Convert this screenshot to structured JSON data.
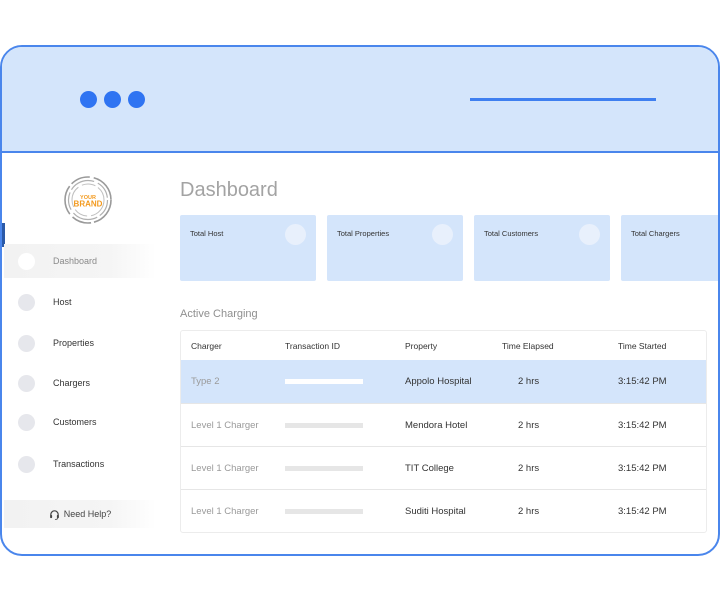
{
  "window": {
    "traffic_dots": [
      "dot",
      "dot",
      "dot"
    ],
    "colors": {
      "accent": "#2f74f2",
      "frame": "#4a86ec",
      "titlebar": "#d4e5fb",
      "card": "#d4e5fb"
    }
  },
  "sidebar": {
    "logo": {
      "line1": "YOUR",
      "line2": "BRAND"
    },
    "items": [
      {
        "label": "Dashboard",
        "icon": "circle-icon",
        "active": true
      },
      {
        "label": "Host",
        "icon": "circle-icon",
        "active": false
      },
      {
        "label": "Properties",
        "icon": "circle-icon",
        "active": false
      },
      {
        "label": "Chargers",
        "icon": "circle-icon",
        "active": false
      },
      {
        "label": "Customers",
        "icon": "circle-icon",
        "active": false
      },
      {
        "label": "Transactions",
        "icon": "circle-icon",
        "active": false
      }
    ],
    "help": {
      "label": "Need Help?",
      "icon": "headset-icon"
    }
  },
  "main": {
    "title": "Dashboard",
    "cards": [
      {
        "label": "Total Host"
      },
      {
        "label": "Total Properties"
      },
      {
        "label": "Total Customers"
      },
      {
        "label": "Total Chargers"
      }
    ],
    "section_title": "Active Charging",
    "table": {
      "columns": [
        "Charger",
        "Transaction ID",
        "Property",
        "Time Elapsed",
        "Time Started"
      ],
      "rows": [
        {
          "charger": "Type 2",
          "property": "Appolo Hospital",
          "elapsed": "2 hrs",
          "started": "3:15:42 PM",
          "highlighted": true
        },
        {
          "charger": "Level 1 Charger",
          "property": "Mendora Hotel",
          "elapsed": "2 hrs",
          "started": "3:15:42 PM",
          "highlighted": false
        },
        {
          "charger": "Level 1 Charger",
          "property": "TIT College",
          "elapsed": "2 hrs",
          "started": "3:15:42 PM",
          "highlighted": false
        },
        {
          "charger": "Level 1 Charger",
          "property": "Suditi Hospital",
          "elapsed": "2 hrs",
          "started": "3:15:42 PM",
          "highlighted": false
        }
      ]
    }
  }
}
